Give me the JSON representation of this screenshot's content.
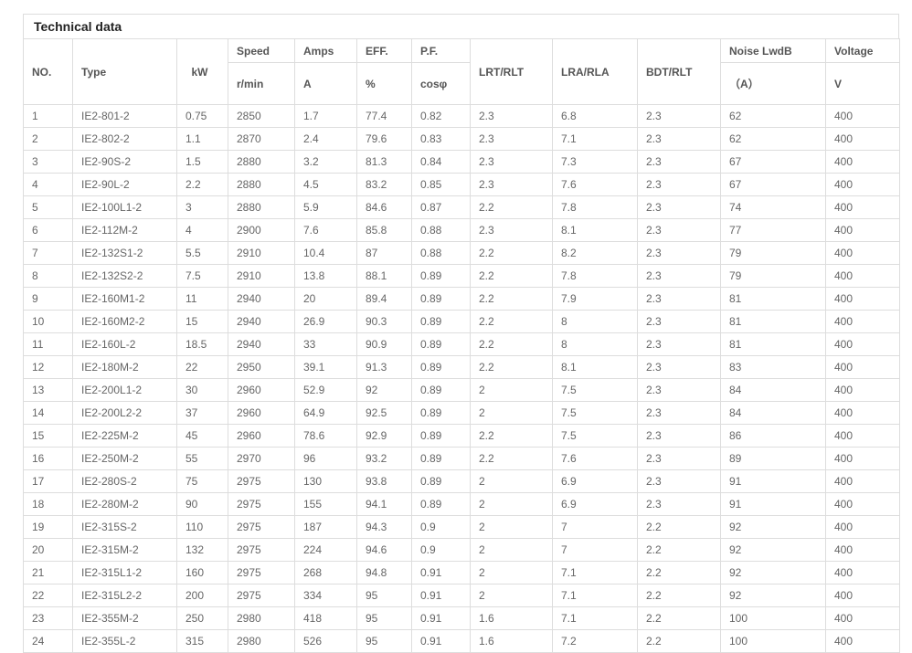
{
  "title": "Technical data",
  "headers": {
    "no": "NO.",
    "type": "Type",
    "kw": "kW",
    "speed": "Speed",
    "speed_unit": "r/min",
    "amps": "Amps",
    "amps_unit": "A",
    "eff": "EFF.",
    "eff_unit": "%",
    "pf": "P.F.",
    "pf_unit": "cosφ",
    "lrt": "LRT/RLT",
    "lra": "LRA/RLA",
    "bdt": "BDT/RLT",
    "noise": "Noise LwdB",
    "noise_unit": "（A）",
    "voltage": "Voltage",
    "voltage_unit": "V"
  },
  "rows": [
    [
      "1",
      "IE2-801-2",
      "0.75",
      "2850",
      "1.7",
      "77.4",
      "0.82",
      "2.3",
      "6.8",
      "2.3",
      "62",
      "400"
    ],
    [
      "2",
      "IE2-802-2",
      "1.1",
      "2870",
      "2.4",
      "79.6",
      "0.83",
      "2.3",
      "7.1",
      "2.3",
      "62",
      "400"
    ],
    [
      "3",
      "IE2-90S-2",
      "1.5",
      "2880",
      "3.2",
      "81.3",
      "0.84",
      "2.3",
      "7.3",
      "2.3",
      "67",
      "400"
    ],
    [
      "4",
      "IE2-90L-2",
      "2.2",
      "2880",
      "4.5",
      "83.2",
      "0.85",
      "2.3",
      "7.6",
      "2.3",
      "67",
      "400"
    ],
    [
      "5",
      "IE2-100L1-2",
      "3",
      "2880",
      "5.9",
      "84.6",
      "0.87",
      "2.2",
      "7.8",
      "2.3",
      "74",
      "400"
    ],
    [
      "6",
      "IE2-112M-2",
      "4",
      "2900",
      "7.6",
      "85.8",
      "0.88",
      "2.3",
      "8.1",
      "2.3",
      "77",
      "400"
    ],
    [
      "7",
      "IE2-132S1-2",
      "5.5",
      "2910",
      "10.4",
      "87",
      "0.88",
      "2.2",
      "8.2",
      "2.3",
      "79",
      "400"
    ],
    [
      "8",
      "IE2-132S2-2",
      "7.5",
      "2910",
      "13.8",
      "88.1",
      "0.89",
      "2.2",
      "7.8",
      "2.3",
      "79",
      "400"
    ],
    [
      "9",
      "IE2-160M1-2",
      "11",
      "2940",
      "20",
      "89.4",
      "0.89",
      "2.2",
      "7.9",
      "2.3",
      "81",
      "400"
    ],
    [
      "10",
      "IE2-160M2-2",
      "15",
      "2940",
      "26.9",
      "90.3",
      "0.89",
      "2.2",
      "8",
      "2.3",
      "81",
      "400"
    ],
    [
      "11",
      "IE2-160L-2",
      "18.5",
      "2940",
      "33",
      "90.9",
      "0.89",
      "2.2",
      "8",
      "2.3",
      "81",
      "400"
    ],
    [
      "12",
      "IE2-180M-2",
      "22",
      "2950",
      "39.1",
      "91.3",
      "0.89",
      "2.2",
      "8.1",
      "2.3",
      "83",
      "400"
    ],
    [
      "13",
      "IE2-200L1-2",
      "30",
      "2960",
      "52.9",
      "92",
      "0.89",
      "2",
      "7.5",
      "2.3",
      "84",
      "400"
    ],
    [
      "14",
      "IE2-200L2-2",
      "37",
      "2960",
      "64.9",
      "92.5",
      "0.89",
      "2",
      "7.5",
      "2.3",
      "84",
      "400"
    ],
    [
      "15",
      "IE2-225M-2",
      "45",
      "2960",
      "78.6",
      "92.9",
      "0.89",
      "2.2",
      "7.5",
      "2.3",
      "86",
      "400"
    ],
    [
      "16",
      "IE2-250M-2",
      "55",
      "2970",
      "96",
      "93.2",
      "0.89",
      "2.2",
      "7.6",
      "2.3",
      "89",
      "400"
    ],
    [
      "17",
      "IE2-280S-2",
      "75",
      "2975",
      "130",
      "93.8",
      "0.89",
      "2",
      "6.9",
      "2.3",
      "91",
      "400"
    ],
    [
      "18",
      "IE2-280M-2",
      "90",
      "2975",
      "155",
      "94.1",
      "0.89",
      "2",
      "6.9",
      "2.3",
      "91",
      "400"
    ],
    [
      "19",
      "IE2-315S-2",
      "110",
      "2975",
      "187",
      "94.3",
      "0.9",
      "2",
      "7",
      "2.2",
      "92",
      "400"
    ],
    [
      "20",
      "IE2-315M-2",
      "132",
      "2975",
      "224",
      "94.6",
      "0.9",
      "2",
      "7",
      "2.2",
      "92",
      "400"
    ],
    [
      "21",
      "IE2-315L1-2",
      "160",
      "2975",
      "268",
      "94.8",
      "0.91",
      "2",
      "7.1",
      "2.2",
      "92",
      "400"
    ],
    [
      "22",
      "IE2-315L2-2",
      "200",
      "2975",
      "334",
      "95",
      "0.91",
      "2",
      "7.1",
      "2.2",
      "92",
      "400"
    ],
    [
      "23",
      "IE2-355M-2",
      "250",
      "2980",
      "418",
      "95",
      "0.91",
      "1.6",
      "7.1",
      "2.2",
      "100",
      "400"
    ],
    [
      "24",
      "IE2-355L-2",
      "315",
      "2980",
      "526",
      "95",
      "0.91",
      "1.6",
      "7.2",
      "2.2",
      "100",
      "400"
    ]
  ]
}
